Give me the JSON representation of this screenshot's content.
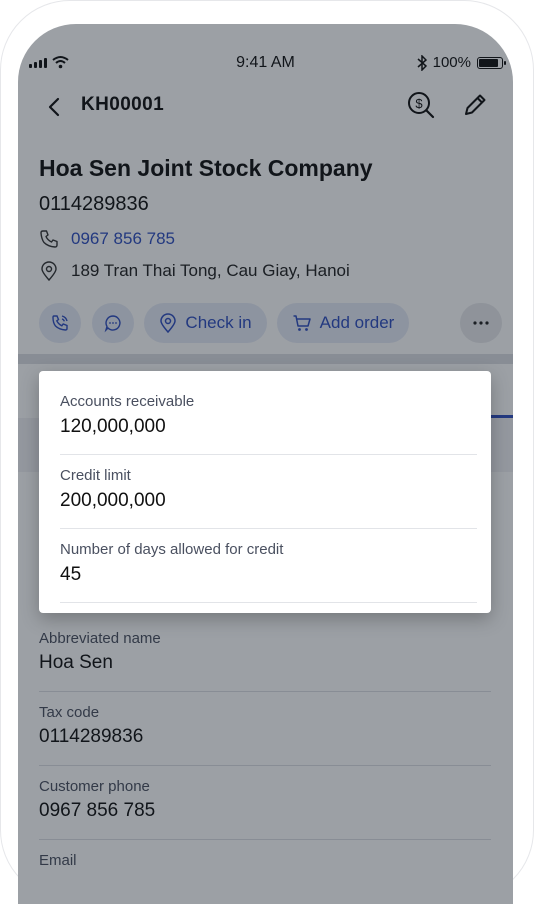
{
  "status_bar": {
    "time": "9:41 AM",
    "battery": "100%"
  },
  "header": {
    "title": "KH00001"
  },
  "customer": {
    "company_name": "Hoa Sen Joint Stock Company",
    "code": "0114289836",
    "phone": "0967 856 785",
    "address": "189 Tran Thai Tong, Cau Giay, Hanoi"
  },
  "actions": {
    "check_in": "Check in",
    "add_order": "Add order"
  },
  "popover": {
    "items": [
      {
        "label": "Accounts receivable",
        "value": "120,000,000"
      },
      {
        "label": "Credit limit",
        "value": "200,000,000"
      },
      {
        "label": "Number of days allowed for credit",
        "value": "45"
      }
    ]
  },
  "details": {
    "abbreviated_name": {
      "label": "Abbreviated name",
      "value": "Hoa Sen"
    },
    "tax_code": {
      "label": "Tax code",
      "value": "0114289836"
    },
    "customer_phone": {
      "label": "Customer phone",
      "value": "0967 856 785"
    },
    "email": {
      "label": "Email"
    }
  },
  "colors": {
    "accent": "#2f4fbf",
    "pill_bg": "#e6eaf7",
    "overlay": "#141c28"
  },
  "icons": [
    "back-icon",
    "finance-search-icon",
    "edit-icon",
    "phone-icon",
    "location-icon",
    "call-icon",
    "chat-icon",
    "cart-icon",
    "more-icon"
  ]
}
